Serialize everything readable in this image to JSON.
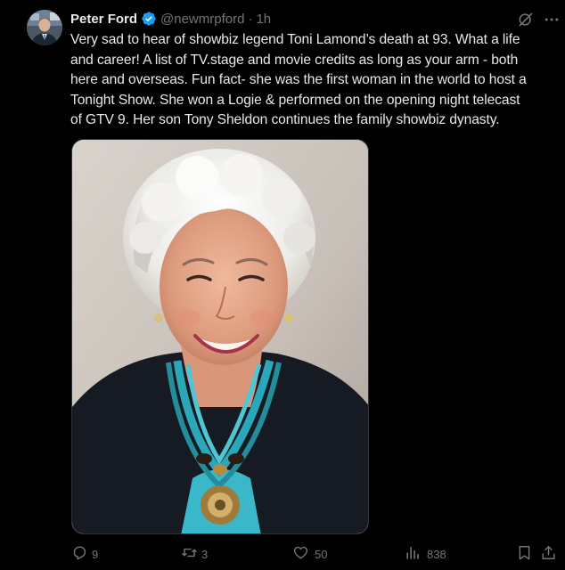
{
  "tweet": {
    "author_name": "Peter Ford",
    "handle": "@newmrpford",
    "separator": "·",
    "time": "1h",
    "verified_color": "#1d9bf0",
    "text": "Very sad to hear of showbiz legend Toni Lamond’s death at 93. What a life\nand career! A list of TV.stage and movie credits as long as your arm - both\nhere and overseas. Fun fact- she was the first woman in the world to host a\nTonight Show. She won a Logie & performed on the opening night telecast\nof GTV 9. Her son Tony Sheldon continues the family showbiz dynasty.",
    "media": {
      "kind": "photo",
      "subject": "portrait of a smiling elderly woman with white hair and turquoise necklace"
    }
  },
  "actions": {
    "replies": "9",
    "reposts": "3",
    "likes": "50",
    "views": "838"
  },
  "icons": {
    "reply": "reply-icon",
    "repost": "repost-icon",
    "like": "heart-icon",
    "views": "views-icon",
    "bookmark": "bookmark-icon",
    "share": "share-icon",
    "grok": "grok-icon",
    "more": "more-icon"
  }
}
